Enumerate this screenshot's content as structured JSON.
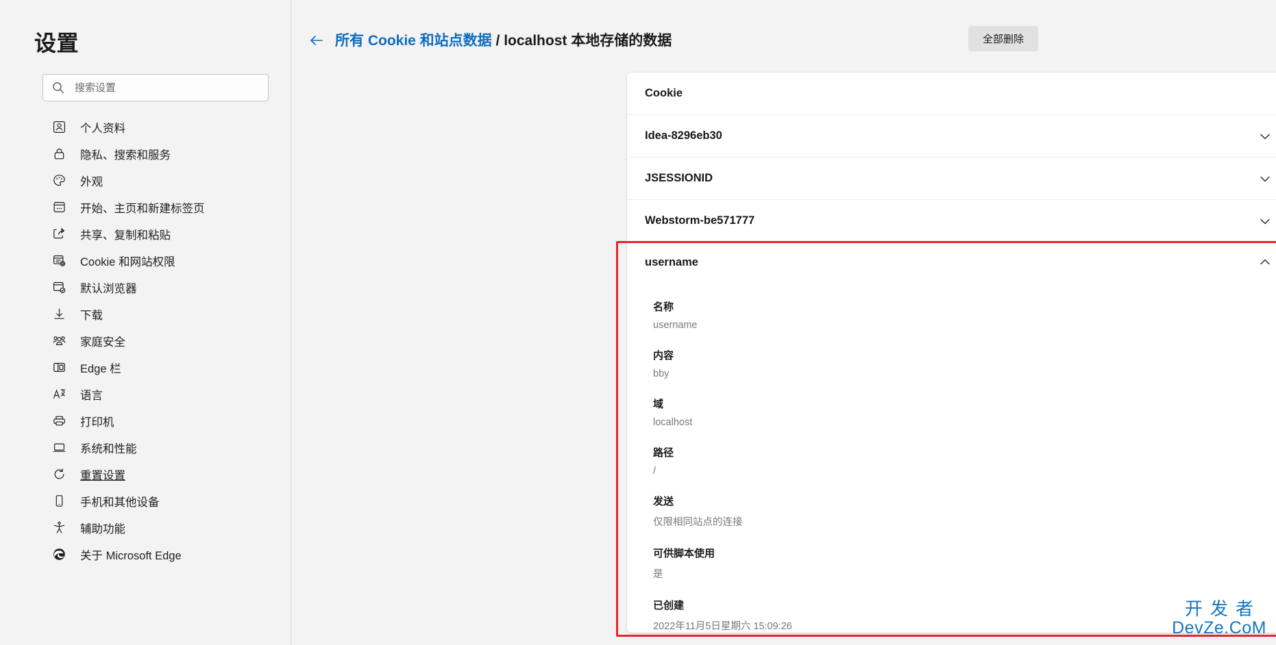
{
  "sidebar": {
    "title": "设置",
    "search": {
      "placeholder": "搜索设置",
      "value": "",
      "icon": "search-icon"
    },
    "items": [
      {
        "label": "个人资料",
        "icon": "profile-icon",
        "name": "profiles"
      },
      {
        "label": "隐私、搜索和服务",
        "icon": "lock-icon",
        "name": "privacy-search-services"
      },
      {
        "label": "外观",
        "icon": "palette-icon",
        "name": "appearance"
      },
      {
        "label": "开始、主页和新建标签页",
        "icon": "start-page-icon",
        "name": "start-home-newtab"
      },
      {
        "label": "共享、复制和粘贴",
        "icon": "share-icon",
        "name": "share-copy-paste"
      },
      {
        "label": "Cookie 和网站权限",
        "icon": "cookie-permissions-icon",
        "name": "cookies-site-permissions"
      },
      {
        "label": "默认浏览器",
        "icon": "default-browser-icon",
        "name": "default-browser"
      },
      {
        "label": "下载",
        "icon": "download-icon",
        "name": "downloads"
      },
      {
        "label": "家庭安全",
        "icon": "family-icon",
        "name": "family-safety"
      },
      {
        "label": "Edge 栏",
        "icon": "edge-bar-icon",
        "name": "edge-bar"
      },
      {
        "label": "语言",
        "icon": "language-icon",
        "name": "languages"
      },
      {
        "label": "打印机",
        "icon": "printer-icon",
        "name": "printers"
      },
      {
        "label": "系统和性能",
        "icon": "system-icon",
        "name": "system-performance"
      },
      {
        "label": "重置设置",
        "icon": "reset-icon",
        "name": "reset-settings",
        "underlined": true
      },
      {
        "label": "手机和其他设备",
        "icon": "phone-icon",
        "name": "phone-other-devices"
      },
      {
        "label": "辅助功能",
        "icon": "accessibility-icon",
        "name": "accessibility"
      },
      {
        "label": "关于 Microsoft Edge",
        "icon": "edge-logo-icon",
        "name": "about-edge"
      }
    ]
  },
  "header": {
    "back_icon": "back-arrow-icon",
    "crumb_link": "所有 Cookie 和站点数据",
    "crumb_sep": " / ",
    "crumb_current": "localhost 本地存储的数据",
    "delete_all_label": "全部删除"
  },
  "card": {
    "section_title": "Cookie",
    "collapsed_rows": [
      {
        "name": "Idea-8296eb30",
        "chevron": "chevron-down-icon",
        "delete": "trash-icon"
      },
      {
        "name": "JSESSIONID",
        "chevron": "chevron-down-icon",
        "delete": "trash-icon"
      },
      {
        "name": "Webstorm-be571777",
        "chevron": "chevron-down-icon",
        "delete": "trash-icon"
      }
    ],
    "expanded_row": {
      "name": "username",
      "chevron": "chevron-up-icon",
      "delete": "trash-icon",
      "details": [
        {
          "label": "名称",
          "value": "username"
        },
        {
          "label": "内容",
          "value": "bby"
        },
        {
          "label": "域",
          "value": "localhost"
        },
        {
          "label": "路径",
          "value": "/"
        },
        {
          "label": "发送",
          "value": "仅限相同站点的连接"
        },
        {
          "label": "可供脚本使用",
          "value": "是"
        },
        {
          "label": "已创建",
          "value": "2022年11月5日星期六 15:09:26"
        }
      ]
    }
  },
  "annotation": {
    "highlight_color": "#e8232e"
  },
  "watermark": {
    "line1": "开发者",
    "line2": "DevZe.CoM",
    "color": "#1675c0"
  }
}
